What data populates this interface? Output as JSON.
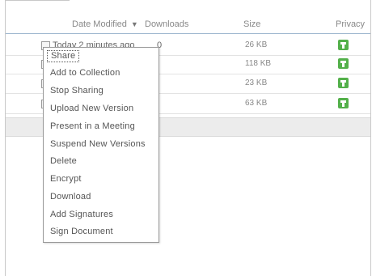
{
  "table": {
    "columns": {
      "date_modified": "Date Modified",
      "downloads": "Downloads",
      "size": "Size",
      "privacy": "Privacy"
    },
    "sort_icon": "sort-down-triangle-icon",
    "rows": [
      {
        "date": "Today 2 minutes ago",
        "downloads": "0",
        "size": "26 KB",
        "privacy_icon": "shared-green-icon"
      },
      {
        "date": "",
        "downloads": "",
        "size": "118 KB",
        "privacy_icon": "shared-green-icon"
      },
      {
        "date": "",
        "downloads": "",
        "size": "23 KB",
        "privacy_icon": "shared-green-icon"
      },
      {
        "date": "",
        "downloads": "",
        "size": "63 KB",
        "privacy_icon": "shared-green-icon"
      }
    ]
  },
  "context_menu": {
    "items": [
      "Share",
      "Add to Collection",
      "Stop Sharing",
      "Upload New Version",
      "Present in a Meeting",
      "Suspend New Versions",
      "Delete",
      "Encrypt",
      "Download",
      "Add Signatures",
      "Sign Document"
    ]
  },
  "colors": {
    "accent_line": "#9fb8d0",
    "privacy_green": "#53b04a"
  }
}
